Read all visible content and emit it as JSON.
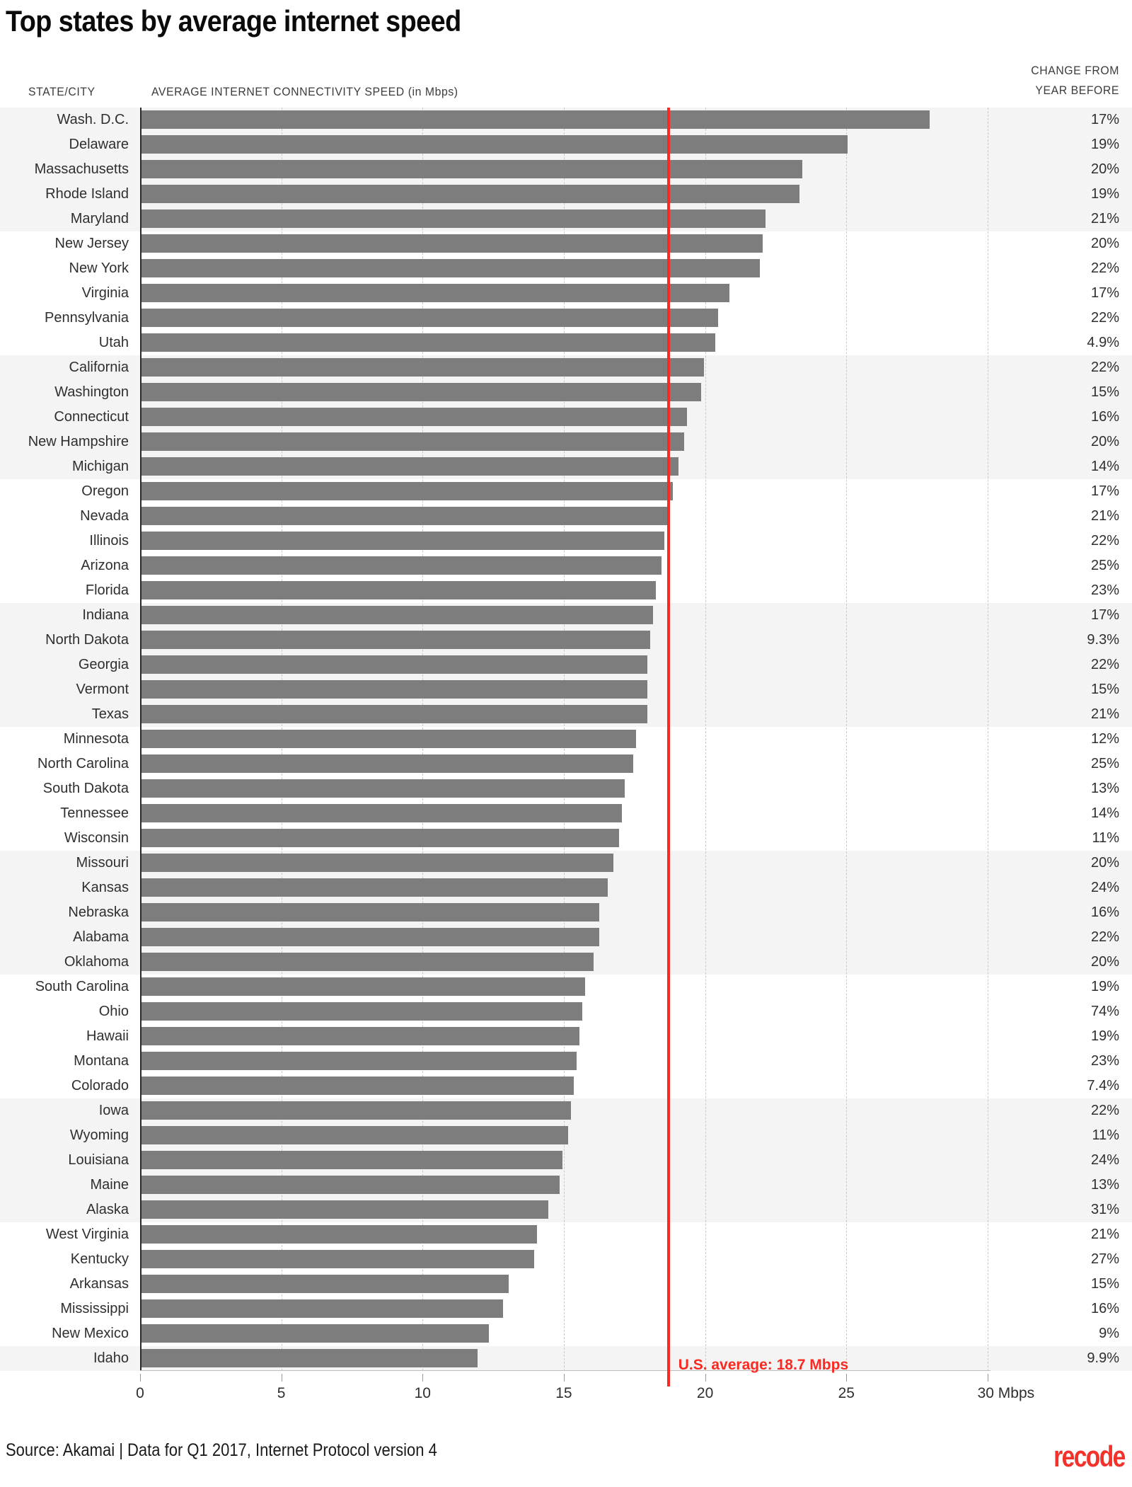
{
  "title": "Top states by average internet speed",
  "headers": {
    "state_city": "STATE/CITY",
    "speed": "AVERAGE INTERNET CONNECTIVITY SPEED (in Mbps)",
    "change_line1": "CHANGE FROM",
    "change_line2": "YEAR BEFORE"
  },
  "annotation": {
    "us_average_label": "U.S. average: 18.7 Mbps",
    "us_average_value": 18.7,
    "color": "#fa2a23"
  },
  "footer": {
    "source": "Source: Akamai | Data for Q1 2017, Internet Protocol version 4",
    "logo": "recode"
  },
  "axis": {
    "ticks": [
      "0",
      "5",
      "10",
      "15",
      "20",
      "25",
      "30 Mbps"
    ],
    "tick_values": [
      0,
      5,
      10,
      15,
      20,
      25,
      30
    ],
    "unit": "Mbps"
  },
  "colors": {
    "bar": "#7d7d7d",
    "band": "#f4f4f4",
    "accent": "#fa2a23",
    "logo": "#f3322c"
  },
  "chart_data": {
    "type": "bar",
    "orientation": "horizontal",
    "title": "Top states by average internet speed",
    "xlabel": "AVERAGE INTERNET CONNECTIVITY SPEED (in Mbps)",
    "ylabel": "STATE/CITY",
    "xlim": [
      0,
      30
    ],
    "grid": true,
    "legend": false,
    "reference_line": {
      "label": "U.S. average: 18.7 Mbps",
      "value": 18.7,
      "color": "#fa2a23"
    },
    "categories": [
      "Wash. D.C.",
      "Delaware",
      "Massachusetts",
      "Rhode Island",
      "Maryland",
      "New Jersey",
      "New York",
      "Virginia",
      "Pennsylvania",
      "Utah",
      "California",
      "Washington",
      "Connecticut",
      "New Hampshire",
      "Michigan",
      "Oregon",
      "Nevada",
      "Illinois",
      "Arizona",
      "Florida",
      "Indiana",
      "North Dakota",
      "Georgia",
      "Vermont",
      "Texas",
      "Minnesota",
      "North Carolina",
      "South Dakota",
      "Tennessee",
      "Wisconsin",
      "Missouri",
      "Kansas",
      "Nebraska",
      "Alabama",
      "Oklahoma",
      "South Carolina",
      "Ohio",
      "Hawaii",
      "Montana",
      "Colorado",
      "Iowa",
      "Wyoming",
      "Louisiana",
      "Maine",
      "Alaska",
      "West Virginia",
      "Kentucky",
      "Arkansas",
      "Mississippi",
      "New Mexico",
      "Idaho"
    ],
    "values": [
      27.9,
      25.0,
      23.4,
      23.3,
      22.1,
      22.0,
      21.9,
      20.8,
      20.4,
      20.3,
      19.9,
      19.8,
      19.3,
      19.2,
      19.0,
      18.8,
      18.6,
      18.5,
      18.4,
      18.2,
      18.1,
      18.0,
      17.9,
      17.9,
      17.9,
      17.5,
      17.4,
      17.1,
      17.0,
      16.9,
      16.7,
      16.5,
      16.2,
      16.2,
      16.0,
      15.7,
      15.6,
      15.5,
      15.4,
      15.3,
      15.2,
      15.1,
      14.9,
      14.8,
      14.4,
      14.0,
      13.9,
      13.0,
      12.8,
      12.3,
      11.9
    ],
    "change_from_year_before": [
      "17%",
      "19%",
      "20%",
      "19%",
      "21%",
      "20%",
      "22%",
      "17%",
      "22%",
      "4.9%",
      "22%",
      "15%",
      "16%",
      "20%",
      "14%",
      "17%",
      "21%",
      "22%",
      "25%",
      "23%",
      "17%",
      "9.3%",
      "22%",
      "15%",
      "21%",
      "12%",
      "25%",
      "13%",
      "14%",
      "11%",
      "20%",
      "24%",
      "16%",
      "22%",
      "20%",
      "19%",
      "74%",
      "19%",
      "23%",
      "7.4%",
      "22%",
      "11%",
      "24%",
      "13%",
      "31%",
      "21%",
      "27%",
      "15%",
      "16%",
      "9%",
      "9.9%"
    ]
  }
}
